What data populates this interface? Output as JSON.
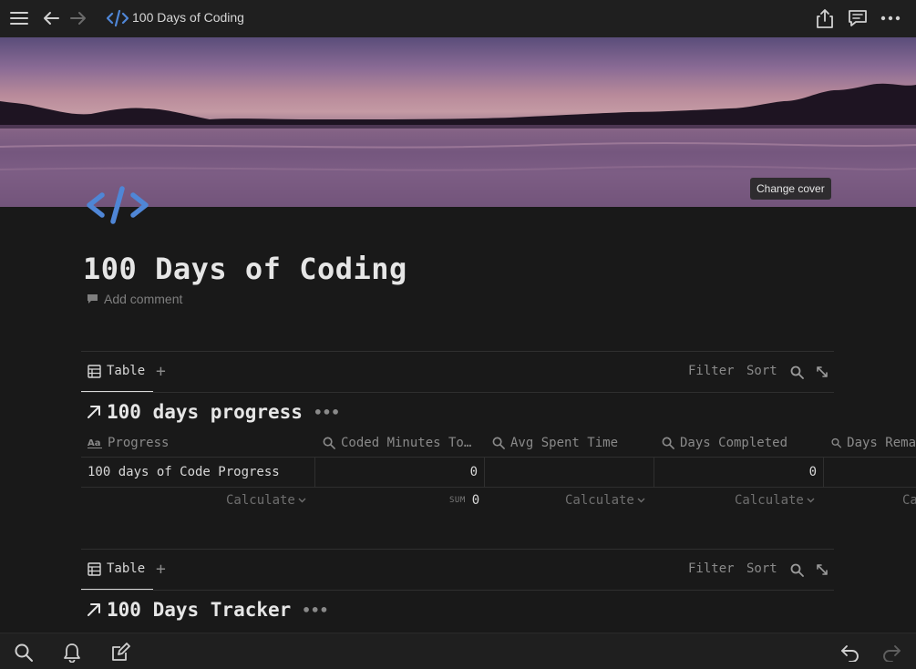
{
  "topbar": {
    "title": "100 Days of Coding"
  },
  "cover": {
    "change_cover_label": "Change cover"
  },
  "page": {
    "title": "100 Days of Coding",
    "add_comment": "Add comment"
  },
  "views": [
    {
      "tab_label": "Table",
      "title": "100 days progress",
      "filter": "Filter",
      "sort": "Sort",
      "columns": [
        "Progress",
        "Coded Minutes To…",
        "Avg Spent Time",
        "Days Completed",
        "Days Rema"
      ],
      "row": {
        "name": "100 days of Code Progress",
        "coded_minutes": "0",
        "avg_spent": "",
        "days_completed": "0"
      },
      "calc_label": "Calculate",
      "sum_label": "SUM",
      "sum_value": "0",
      "calc_partial": "Ca"
    },
    {
      "tab_label": "Table",
      "title": "100 Days Tracker",
      "filter": "Filter",
      "sort": "Sort"
    }
  ],
  "colors": {
    "accent_blue": "#4f86d6",
    "background": "#191919"
  }
}
